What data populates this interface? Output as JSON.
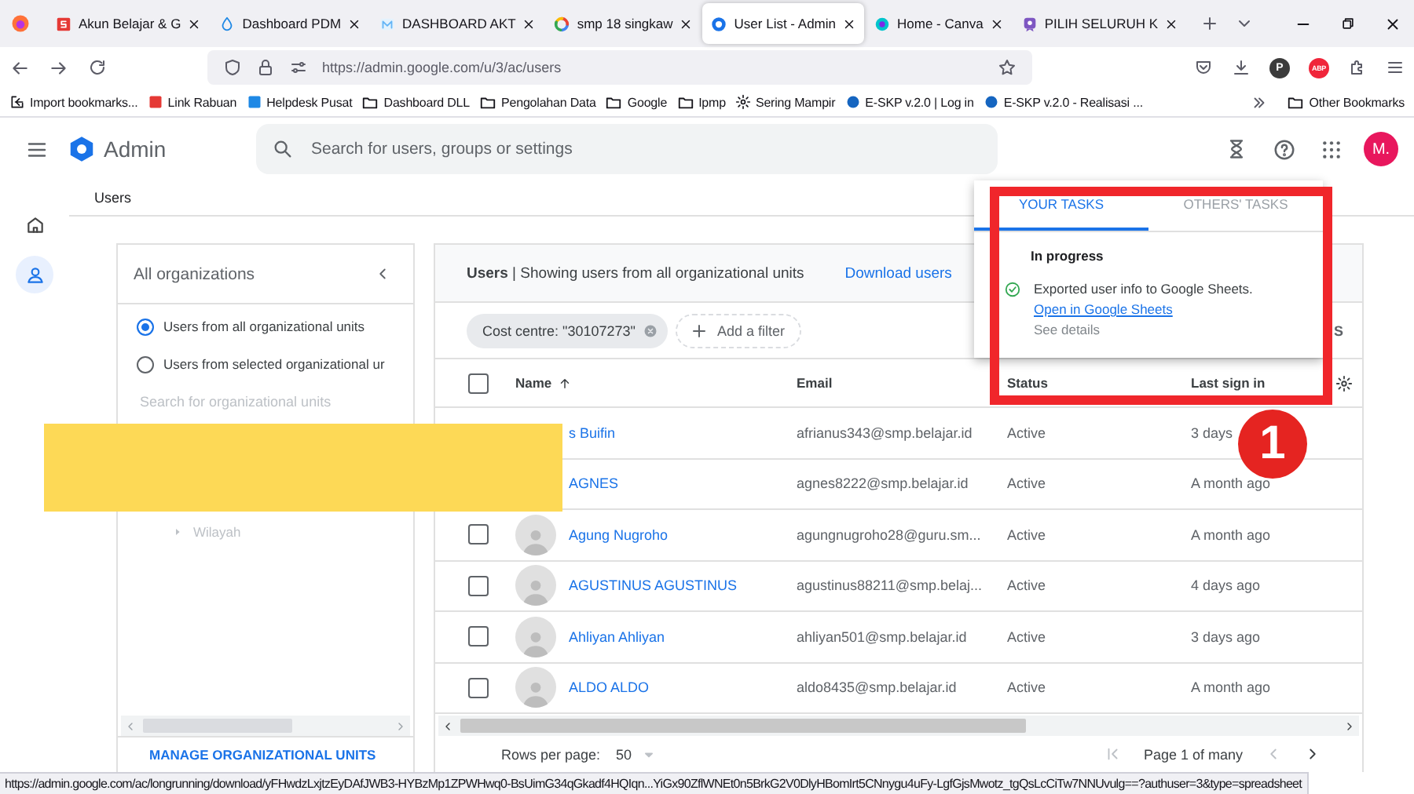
{
  "browser": {
    "tabs": [
      {
        "title": "Akun Belajar & G",
        "selected": false
      },
      {
        "title": "Dashboard PDM",
        "selected": false
      },
      {
        "title": "DASHBOARD AKT",
        "selected": false
      },
      {
        "title": "smp 18 singkaw",
        "selected": false
      },
      {
        "title": "User List - Admin",
        "selected": true
      },
      {
        "title": "Home - Canva",
        "selected": false
      },
      {
        "title": "PILIH SELURUH K",
        "selected": false
      }
    ],
    "address": "https://admin.google.com/u/3/ac/users",
    "extension_badges": [
      "P",
      "ABP"
    ],
    "bookmarks": [
      {
        "kind": "import",
        "label": "Import bookmarks..."
      },
      {
        "kind": "site",
        "label": "Link Rabuan"
      },
      {
        "kind": "site",
        "label": "Helpdesk Pusat"
      },
      {
        "kind": "folder",
        "label": "Dashboard DLL"
      },
      {
        "kind": "folder",
        "label": "Pengolahan Data"
      },
      {
        "kind": "folder",
        "label": "Google"
      },
      {
        "kind": "folder",
        "label": "Ipmp"
      },
      {
        "kind": "gear",
        "label": "Sering Mampir"
      },
      {
        "kind": "site",
        "label": "E-SKP v.2.0 | Log in"
      },
      {
        "kind": "site",
        "label": "E-SKP v.2.0 - Realisasi ..."
      }
    ],
    "other_bookmarks": "Other Bookmarks"
  },
  "app": {
    "title": "Admin",
    "search": {
      "placeholder": "Search for users, groups or settings"
    },
    "avatar": "M.",
    "nav_rail": [
      {
        "kind": "home",
        "selected": false
      },
      {
        "kind": "users",
        "selected": true
      }
    ],
    "breadcrumb": "Users",
    "org_panel": {
      "title": "All organizations",
      "options": [
        {
          "label": "Users from all organizational units",
          "selected": true
        },
        {
          "label": "Users from selected organizational ur",
          "selected": false
        }
      ],
      "search": {
        "placeholder": "Search for organizational units"
      },
      "tree": [
        {
          "label": "Wilayah",
          "expanded": false
        }
      ],
      "manage_link": "MANAGE ORGANIZATIONAL UNITS"
    },
    "users_panel": {
      "heading": "**Users** | Showing users from all organizational units",
      "download_link": "Download users",
      "filters": [
        {
          "label": "Cost centre: \"30107273\""
        }
      ],
      "add_filter": "Add a filter",
      "filters_toggle": "S",
      "select_all": {
        "checked": false
      },
      "columns": [
        {
          "label": "Name",
          "sorted": true
        },
        {
          "label": "Email",
          "sorted": false
        },
        {
          "label": "Status",
          "sorted": false
        },
        {
          "label": "Last sign in",
          "sorted": false
        }
      ],
      "rows": [
        {
          "name": "s Buifin",
          "email": "afrianus343@smp.belajar.id",
          "status": "Active",
          "last_sign_in": "3 days"
        },
        {
          "name": "AGNES",
          "email": "agnes8222@smp.belajar.id",
          "status": "Active",
          "last_sign_in": "A month ago"
        },
        {
          "name": "Agung Nugroho",
          "email": "agungnugroho28@guru.sm...",
          "status": "Active",
          "last_sign_in": "A month ago",
          "checked": false
        },
        {
          "name": "AGUSTINUS AGUSTINUS",
          "email": "agustinus88211@smp.belaj...",
          "status": "Active",
          "last_sign_in": "4 days ago",
          "checked": false
        },
        {
          "name": "Ahliyan Ahliyan",
          "email": "ahliyan501@smp.belajar.id",
          "status": "Active",
          "last_sign_in": "3 days ago",
          "checked": false
        },
        {
          "name": "ALDO ALDO",
          "email": "aldo8435@smp.belajar.id",
          "status": "Active",
          "last_sign_in": "A month ago",
          "checked": false
        }
      ],
      "rows_per_page_label": "Rows per page:",
      "rows_per_page": "50",
      "page_label": "Page 1 of many"
    }
  },
  "tasks_popup": {
    "tabs": [
      {
        "label": "YOUR TASKS",
        "selected": true
      },
      {
        "label": "OTHERS' TASKS",
        "selected": false
      }
    ],
    "section": "In progress",
    "task": {
      "message": "Exported user info to Google Sheets.",
      "link": "Open in Google Sheets",
      "details": "See details"
    }
  },
  "annotation": {
    "badge": "1"
  },
  "status_bar": "https://admin.google.com/ac/longrunning/download/yFHwdzLxjtzEyDAfJWB3-HYBzMp1ZPWHwq0-BsUimG34qGkadf4HQIqn...YiGx90ZflWNEt0n5BrkG2V0DlyHBomIrt5CNnygu4uFy-LgfGjsMwotz_tgQsLcCiTw7NNUvulg==?authuser=3&type=spreadsheet"
}
